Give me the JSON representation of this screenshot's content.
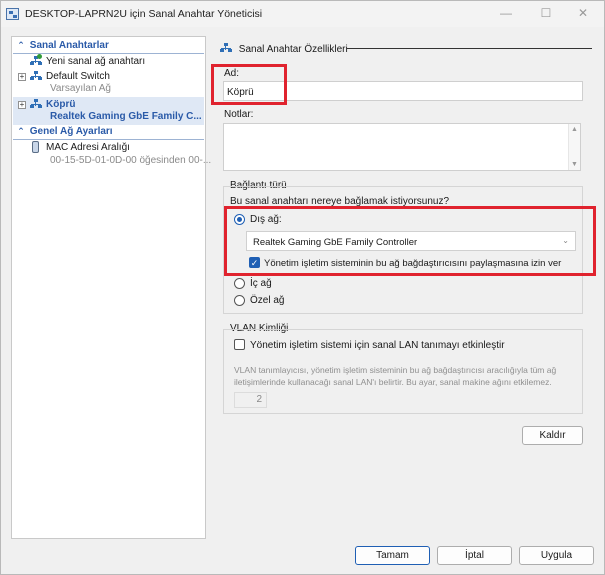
{
  "window": {
    "title": "DESKTOP-LAPRN2U için Sanal Anahtar Yöneticisi",
    "minimize": "—",
    "maximize": "☐",
    "close": "✕"
  },
  "tree": {
    "section1": "Sanal Anahtarlar",
    "new_switch": "Yeni sanal ağ anahtarı",
    "default_switch": "Default Switch",
    "default_switch_sub": "Varsayılan Ağ",
    "bridge": "Köprü",
    "bridge_sub": "Realtek Gaming GbE Family C...",
    "section2": "Genel Ağ Ayarları",
    "mac_range": "MAC Adresi Aralığı",
    "mac_range_sub": "00-15-5D-01-0D-00 öğesinden 00-..."
  },
  "properties": {
    "header": "Sanal Anahtar Özellikleri",
    "name_label": "Ad:",
    "name_value": "Köprü",
    "notes_label": "Notlar:",
    "conn_type_label": "Bağlantı türü",
    "conn_question": "Bu sanal anahtarı nereye bağlamak istiyorsunuz?",
    "external_label": "Dış ağ:",
    "adapter_selected": "Realtek Gaming GbE Family Controller",
    "allow_mgmt_os": "Yönetim işletim sisteminin bu ağ bağdaştırıcısını paylaşmasına izin ver",
    "internal_label": "İç ağ",
    "private_label": "Özel ağ",
    "vlan_label": "VLAN Kimliği",
    "vlan_enable": "Yönetim işletim sistemi için sanal LAN tanımayı etkinleştir",
    "vlan_desc_1": "VLAN tanımlayıcısı, yönetim işletim sisteminin bu ağ bağdaştırıcısı aracılığıyla tüm ağ",
    "vlan_desc_2": "iletişimlerinde kullanacağı sanal LAN'ı belirtir. Bu ayar, sanal makine ağını etkilemez.",
    "vlan_value": "2",
    "remove_button": "Kaldır"
  },
  "footer": {
    "ok": "Tamam",
    "cancel": "İptal",
    "apply": "Uygula"
  },
  "colors": {
    "highlight_box": "#e0232e",
    "accent": "#1f5fb4",
    "section_header": "#2a5aa8"
  }
}
